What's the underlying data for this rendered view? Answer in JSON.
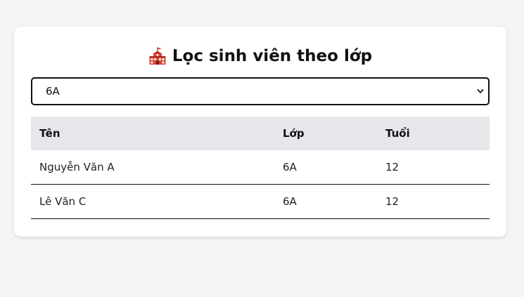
{
  "page": {
    "title": "Lọc sinh viên theo lớp",
    "title_icon": "school-building-icon"
  },
  "filter": {
    "selected": "6A",
    "arrow_icon": "chevron-down-icon"
  },
  "table": {
    "headers": [
      "Tên",
      "Lớp",
      "Tuổi"
    ],
    "rows": [
      [
        "Nguyễn Văn A",
        "6A",
        "12"
      ],
      [
        "Lê Văn C",
        "6A",
        "12"
      ]
    ]
  },
  "colors": {
    "background": "#f3f4f6",
    "card": "#ffffff",
    "header_row": "#e5e7eb",
    "text": "#111111"
  }
}
